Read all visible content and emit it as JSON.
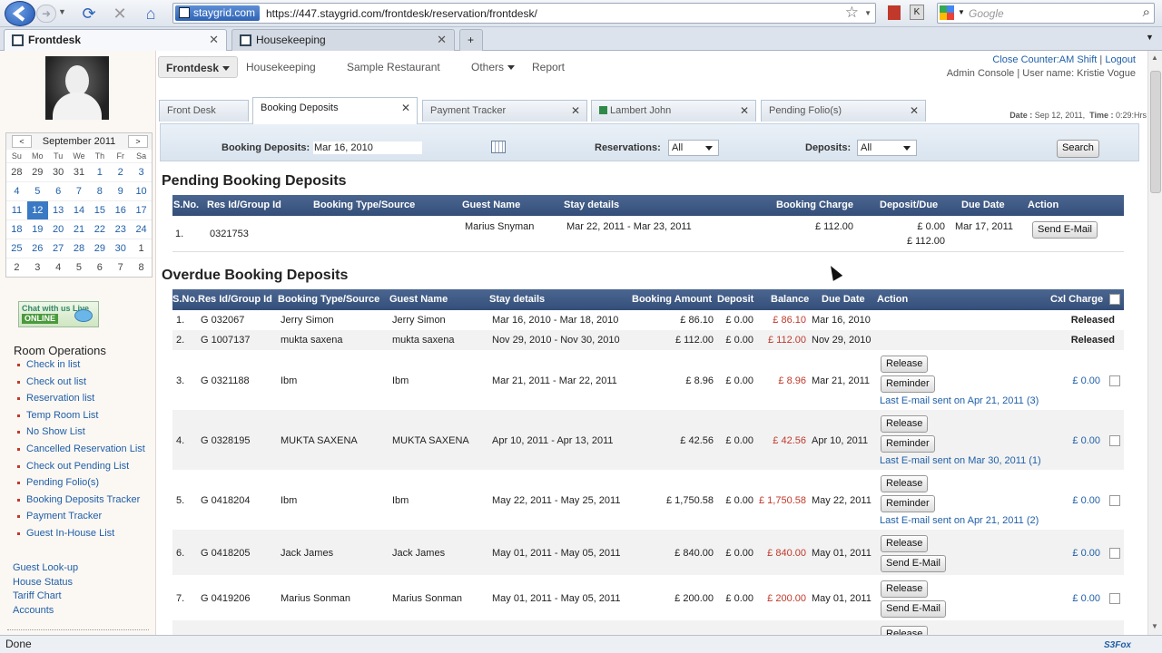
{
  "browser": {
    "site_badge": "staygrid.com",
    "url": "https://447.staygrid.com/frontdesk/reservation/frontdesk/",
    "search_placeholder": "Google",
    "tabs": [
      {
        "label": "Frontdesk",
        "close": "✕"
      },
      {
        "label": "Housekeeping",
        "close": "✕"
      }
    ],
    "new_tab": "+",
    "status": "Done",
    "addon_badge": "S3Fox"
  },
  "app_nav": {
    "items": [
      "Frontdesk",
      "Housekeeping",
      "Sample Restaurant",
      "Others",
      "Report"
    ]
  },
  "account": {
    "line1_a": "Close Counter:AM Shift",
    "line1_b": "Logout",
    "line2": "Admin Console | User name: Kristie Vogue",
    "date_label": "Date :",
    "date_value": "Sep 12, 2011,",
    "time_label": "Time :",
    "time_value": "0:29:Hrs"
  },
  "calendar": {
    "prev": "<",
    "next": ">",
    "month": "September 2011",
    "dows": [
      "Su",
      "Mo",
      "Tu",
      "We",
      "Th",
      "Fr",
      "Sa"
    ],
    "days": [
      [
        "28",
        "29",
        "30",
        "31",
        "1",
        "2",
        "3"
      ],
      [
        "4",
        "5",
        "6",
        "7",
        "8",
        "9",
        "10"
      ],
      [
        "11",
        "12",
        "13",
        "14",
        "15",
        "16",
        "17"
      ],
      [
        "18",
        "19",
        "20",
        "21",
        "22",
        "23",
        "24"
      ],
      [
        "25",
        "26",
        "27",
        "28",
        "29",
        "30",
        "1"
      ],
      [
        "2",
        "3",
        "4",
        "5",
        "6",
        "7",
        "8"
      ]
    ],
    "today": "12"
  },
  "chat": {
    "line1": "Chat with us Live",
    "line2": "ONLINE"
  },
  "sidebar": {
    "section_title": "Room Operations",
    "room_ops": [
      "Check in list",
      "Check out list",
      "Reservation list",
      "Temp Room List",
      "No Show List",
      "Cancelled Reservation List",
      "Check out Pending List",
      "Pending Folio(s)",
      "Booking Deposits Tracker",
      "Payment Tracker",
      "Guest In-House List"
    ],
    "more": [
      "Guest Look-up",
      "House Status",
      "Tariff Chart",
      "Accounts"
    ]
  },
  "content_tabs": [
    {
      "label": "Front Desk"
    },
    {
      "label": "Booking Deposits",
      "close": "✕"
    },
    {
      "label": "Payment Tracker",
      "close": "✕"
    },
    {
      "label": "Lambert John",
      "close": "✕"
    },
    {
      "label": "Pending Folio(s)",
      "close": "✕"
    }
  ],
  "filter": {
    "booking_label": "Booking Deposits:",
    "booking_value": "Mar 16, 2010",
    "res_label": "Reservations:",
    "res_value": "All",
    "dep_label": "Deposits:",
    "dep_value": "All",
    "search": "Search"
  },
  "pending": {
    "title": "Pending Booking Deposits",
    "headers": [
      "S.No.",
      "Res Id/Group Id",
      "Booking Type/Source",
      "Guest Name",
      "Stay details",
      "Booking Charge",
      "Deposit/Due",
      "Due Date",
      "Action"
    ],
    "row": {
      "sno": "1.",
      "res": "0321753",
      "guest": "Marius Snyman",
      "stay": "Mar 22, 2011 - Mar 23, 2011",
      "charge": "£ 112.00",
      "deposit": "£ 0.00",
      "due": "£ 112.00",
      "due_date": "Mar 17, 2011",
      "action": "Send E-Mail"
    }
  },
  "overdue": {
    "title": "Overdue Booking Deposits",
    "headers": [
      "S.No.",
      "Res Id/Group Id",
      "Booking Type/Source",
      "Guest Name",
      "Stay details",
      "Booking Amount",
      "Deposit",
      "Balance",
      "Due Date",
      "Action",
      "Cxl Charge"
    ],
    "rows": [
      {
        "sno": "1.",
        "res": "G 032067",
        "source": "Jerry Simon",
        "guest": "Jerry Simon",
        "stay": "Mar 16, 2010 - Mar 18, 2010",
        "amount": "£ 86.10",
        "deposit": "£ 0.00",
        "balance": "£ 86.10",
        "due_date": "Mar 16, 2010",
        "cxl": "Released"
      },
      {
        "sno": "2.",
        "res": "G 1007137",
        "source": "mukta saxena",
        "guest": "mukta saxena",
        "stay": "Nov 29, 2010 - Nov 30, 2010",
        "amount": "£ 112.00",
        "deposit": "£ 0.00",
        "balance": "£ 112.00",
        "due_date": "Nov 29, 2010",
        "cxl": "Released"
      },
      {
        "sno": "3.",
        "res": "G 0321188",
        "source": "Ibm",
        "guest": "Ibm",
        "stay": "Mar 21, 2011 - Mar 22, 2011",
        "amount": "£ 8.96",
        "deposit": "£ 0.00",
        "balance": "£ 8.96",
        "due_date": "Mar 21, 2011",
        "btn1": "Release",
        "btn2": "Reminder",
        "note": "Last E-mail sent on Apr 21, 2011 (3)",
        "cxl": "£ 0.00"
      },
      {
        "sno": "4.",
        "res": "G 0328195",
        "source": "MUKTA SAXENA",
        "guest": "MUKTA SAXENA",
        "stay": "Apr 10, 2011 - Apr 13, 2011",
        "amount": "£ 42.56",
        "deposit": "£ 0.00",
        "balance": "£ 42.56",
        "due_date": "Apr 10, 2011",
        "btn1": "Release",
        "btn2": "Reminder",
        "note": "Last E-mail sent on Mar 30, 2011 (1)",
        "cxl": "£ 0.00"
      },
      {
        "sno": "5.",
        "res": "G 0418204",
        "source": "Ibm",
        "guest": "Ibm",
        "stay": "May 22, 2011 - May 25, 2011",
        "amount": "£ 1,750.58",
        "deposit": "£ 0.00",
        "balance": "£ 1,750.58",
        "due_date": "May 22, 2011",
        "btn1": "Release",
        "btn2": "Reminder",
        "note": "Last E-mail sent on Apr 21, 2011 (2)",
        "cxl": "£ 0.00"
      },
      {
        "sno": "6.",
        "res": "G 0418205",
        "source": "Jack James",
        "guest": "Jack James",
        "stay": "May 01, 2011 - May 05, 2011",
        "amount": "£ 840.00",
        "deposit": "£ 0.00",
        "balance": "£ 840.00",
        "due_date": "May 01, 2011",
        "btn1": "Release",
        "btn2": "Send E-Mail",
        "cxl": "£ 0.00"
      },
      {
        "sno": "7.",
        "res": "G 0419206",
        "source": "Marius Sonman",
        "guest": "Marius Sonman",
        "stay": "May 01, 2011 - May 05, 2011",
        "amount": "£ 200.00",
        "deposit": "£ 0.00",
        "balance": "£ 200.00",
        "due_date": "May 01, 2011",
        "btn1": "Release",
        "btn2": "Send E-Mail",
        "cxl": "£ 0.00"
      },
      {
        "btn1": "Release"
      }
    ]
  },
  "colors": {
    "header_bg": "#3d5a85",
    "link": "#1f5fa8",
    "balance": "#c0392b"
  }
}
